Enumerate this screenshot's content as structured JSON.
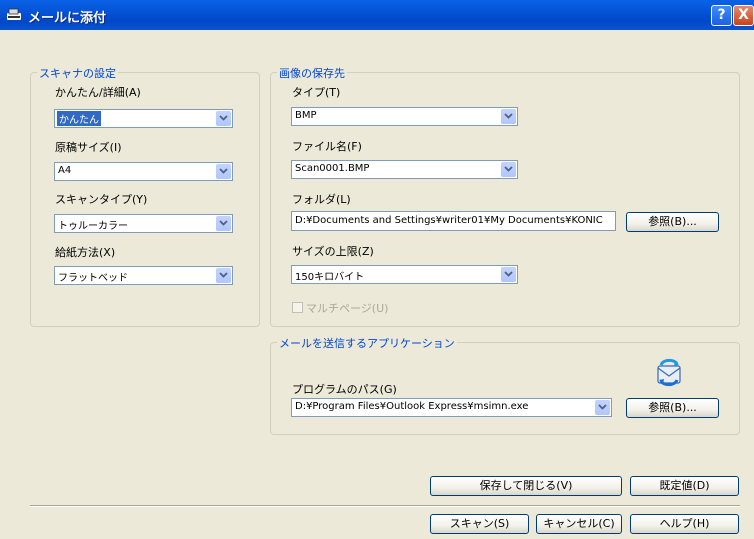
{
  "window": {
    "title": "メールに添付",
    "help_symbol": "?",
    "close_symbol": "X"
  },
  "scanner_settings": {
    "group_title": "スキャナの設定",
    "mode": {
      "label": "かんたん/詳細(A)",
      "value": "かんたん"
    },
    "paper_size": {
      "label": "原稿サイズ(I)",
      "value": "A4"
    },
    "scan_type": {
      "label": "スキャンタイプ(Y)",
      "value": "トゥルーカラー"
    },
    "feed_method": {
      "label": "給紙方法(X)",
      "value": "フラットベッド"
    }
  },
  "save_destination": {
    "group_title": "画像の保存先",
    "type": {
      "label": "タイプ(T)",
      "value": "BMP"
    },
    "file_name": {
      "label": "ファイル名(F)",
      "value": "Scan0001.BMP"
    },
    "folder": {
      "label": "フォルダ(L)",
      "value": "D:¥Documents and Settings¥writer01¥My Documents¥KONIC",
      "browse_button": "参照(B)..."
    },
    "size_limit": {
      "label": "サイズの上限(Z)",
      "value": "150キロバイト"
    },
    "multipage": {
      "label": "マルチページ(U)",
      "checked": false,
      "enabled": false
    }
  },
  "mail_app": {
    "group_title": "メールを送信するアプリケーション",
    "program_path": {
      "label": "プログラムのパス(G)",
      "value": "D:¥Program Files¥Outlook Express¥msimn.exe",
      "browse_button": "参照(B)..."
    },
    "app_icon": "outlook-express-icon"
  },
  "buttons": {
    "save_close": "保存して閉じる(V)",
    "defaults": "既定値(D)",
    "scan": "スキャン(S)",
    "cancel": "キャンセル(C)",
    "help": "ヘルプ(H)"
  },
  "colors": {
    "titlebar": "#0453d7",
    "group_title": "#0046d5",
    "dialog_bg": "#ece9d8",
    "selection": "#316ac5"
  }
}
